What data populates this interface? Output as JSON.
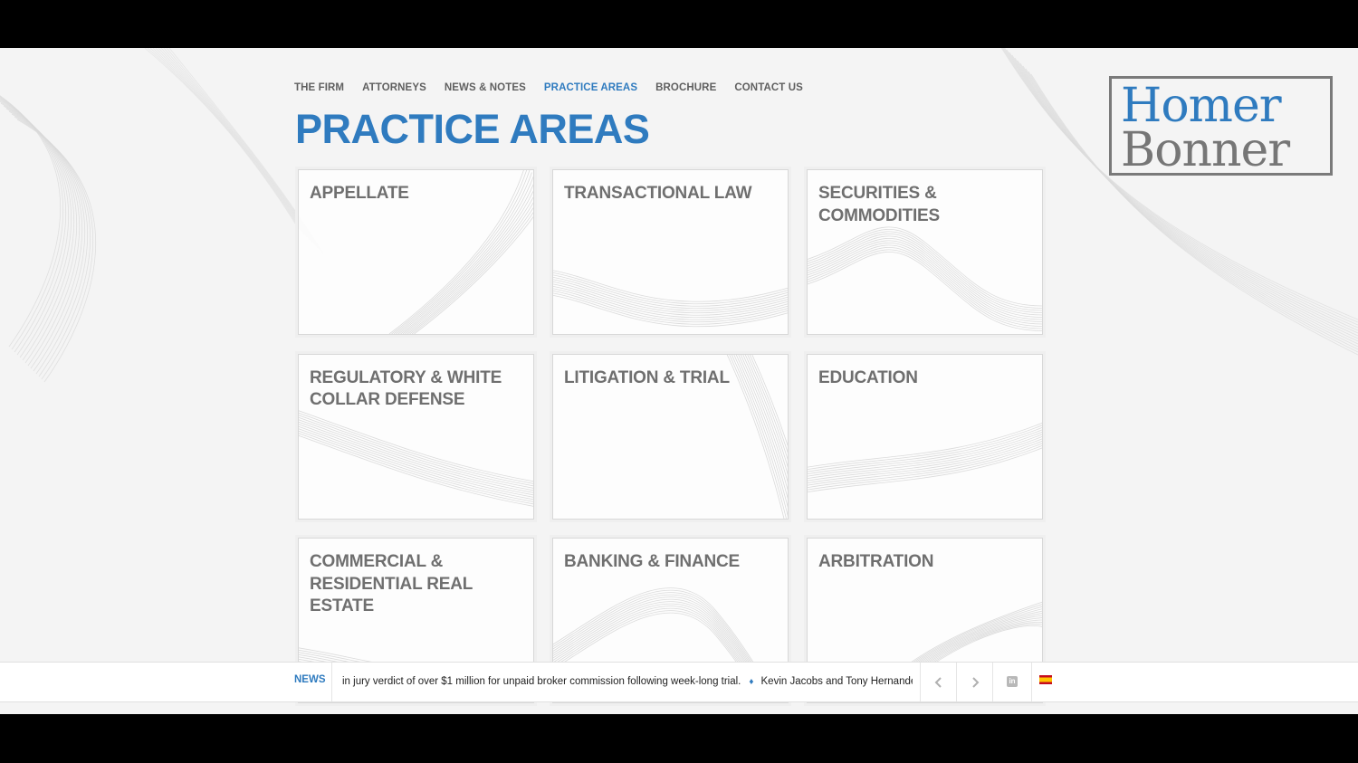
{
  "nav": {
    "items": [
      "THE FIRM",
      "ATTORNEYS",
      "NEWS & NOTES",
      "PRACTICE AREAS",
      "BROCHURE",
      "CONTACT US"
    ],
    "active": "PRACTICE AREAS"
  },
  "page_title": "PRACTICE AREAS",
  "logo": {
    "line1": "Homer",
    "line2": "Bonner"
  },
  "practice_areas": [
    "APPELLATE",
    "TRANSACTIONAL LAW",
    "SECURITIES & COMMODITIES",
    "REGULATORY & WHITE COLLAR DEFENSE",
    "LITIGATION & TRIAL",
    "EDUCATION",
    "COMMERCIAL & RESIDENTIAL REAL ESTATE",
    "BANKING & FINANCE",
    "ARBITRATION"
  ],
  "news": {
    "label": "NEWS",
    "items": [
      "in jury verdict of over $1 million for unpaid broker commission following week-long trial.",
      "Kevin Jacobs and Tony Hernandez were"
    ],
    "separator": "♦"
  },
  "icons": {
    "prev": "chevron-left-icon",
    "next": "chevron-right-icon",
    "social": "linkedin-icon",
    "language": "spanish-flag-icon"
  },
  "colors": {
    "accent": "#2f7bbf",
    "text": "#6f6f6f",
    "nav": "#5f5f5f"
  }
}
